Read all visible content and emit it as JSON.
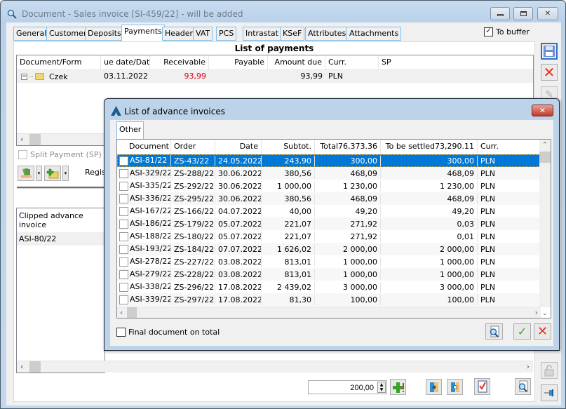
{
  "window": {
    "title": "Document - Sales invoice [SI-459/22]  - will be added",
    "minimize_icon": "minimize-icon",
    "maximize_icon": "maximize-icon",
    "close_icon": "close-icon"
  },
  "tabs": [
    {
      "label": "General"
    },
    {
      "label": "Customer"
    },
    {
      "label": "Deposits"
    },
    {
      "label": "Payments",
      "active": true
    },
    {
      "label": "Header"
    },
    {
      "label": "VAT"
    },
    {
      "label": "PCS"
    },
    {
      "label": "Intrastat"
    },
    {
      "label": "KSeF"
    },
    {
      "label": "Attributes"
    },
    {
      "label": "Attachments"
    }
  ],
  "to_buffer": {
    "label": "To buffer",
    "checked": true
  },
  "payments": {
    "title": "List of payments",
    "columns": [
      "Document/Form",
      "ue date/Date",
      "Receivable",
      "Payable",
      "Amount due",
      "Curr.",
      "SP"
    ],
    "rows": [
      {
        "document": "Czek",
        "date": "03.11.2022",
        "receivable": "93,99",
        "payable": "",
        "amount_due": "93,99",
        "curr": "PLN",
        "sp": ""
      }
    ],
    "receivable_color": "#e0001a"
  },
  "split_payment": {
    "label": "Split Payment (SP)",
    "checked": false
  },
  "registry_label": "Regis",
  "clipped": {
    "header": "Clipped advance invoice",
    "rows": [
      "ASI-80/22"
    ]
  },
  "bottom": {
    "amount_value": "200,00"
  },
  "dialog": {
    "title": "List of advance invoices",
    "tab": "Other",
    "columns": [
      "Document",
      "Order",
      "Date",
      "Subtot.",
      "Total76,373.36",
      "To be settled73,290.11",
      "Curr."
    ],
    "rows": [
      {
        "document": "ASI-81/22",
        "order": "ZS-43/22",
        "date": "24.05.2022",
        "subtotal": "243,90",
        "total": "300,00",
        "to_settle": "300,00",
        "curr": "PLN",
        "selected": true
      },
      {
        "document": "ASI-329/22",
        "order": "ZS-288/22",
        "date": "30.06.2022",
        "subtotal": "380,56",
        "total": "468,09",
        "to_settle": "468,09",
        "curr": "PLN"
      },
      {
        "document": "ASI-335/22",
        "order": "ZS-292/22",
        "date": "30.06.2022",
        "subtotal": "1 000,00",
        "total": "1 230,00",
        "to_settle": "1 230,00",
        "curr": "PLN"
      },
      {
        "document": "ASI-336/22",
        "order": "ZS-295/22",
        "date": "30.06.2022",
        "subtotal": "380,56",
        "total": "468,09",
        "to_settle": "468,09",
        "curr": "PLN"
      },
      {
        "document": "ASI-167/22",
        "order": "ZS-166/22",
        "date": "04.07.2022",
        "subtotal": "40,00",
        "total": "49,20",
        "to_settle": "49,20",
        "curr": "PLN"
      },
      {
        "document": "ASI-186/22",
        "order": "ZS-179/22",
        "date": "05.07.2022",
        "subtotal": "221,07",
        "total": "271,92",
        "to_settle": "0,03",
        "curr": "PLN"
      },
      {
        "document": "ASI-188/22",
        "order": "ZS-180/22",
        "date": "05.07.2022",
        "subtotal": "221,07",
        "total": "271,92",
        "to_settle": "0,01",
        "curr": "PLN"
      },
      {
        "document": "ASI-193/22",
        "order": "ZS-184/22",
        "date": "07.07.2022",
        "subtotal": "1 626,02",
        "total": "2 000,00",
        "to_settle": "2 000,00",
        "curr": "PLN"
      },
      {
        "document": "ASI-278/22",
        "order": "ZS-227/22",
        "date": "03.08.2022",
        "subtotal": "813,01",
        "total": "1 000,00",
        "to_settle": "1 000,00",
        "curr": "PLN"
      },
      {
        "document": "ASI-279/22",
        "order": "ZS-228/22",
        "date": "03.08.2022",
        "subtotal": "813,01",
        "total": "1 000,00",
        "to_settle": "1 000,00",
        "curr": "PLN"
      },
      {
        "document": "ASI-338/22",
        "order": "ZS-296/22",
        "date": "17.08.2022",
        "subtotal": "2 439,02",
        "total": "3 000,00",
        "to_settle": "3 000,00",
        "curr": "PLN"
      },
      {
        "document": "ASI-339/22",
        "order": "ZS-297/22",
        "date": "17.08.2022",
        "subtotal": "81,30",
        "total": "100,00",
        "to_settle": "100,00",
        "curr": "PLN"
      }
    ],
    "final_document": {
      "label": "Final document on total",
      "checked": false
    },
    "selection_color": "#0078d7"
  }
}
